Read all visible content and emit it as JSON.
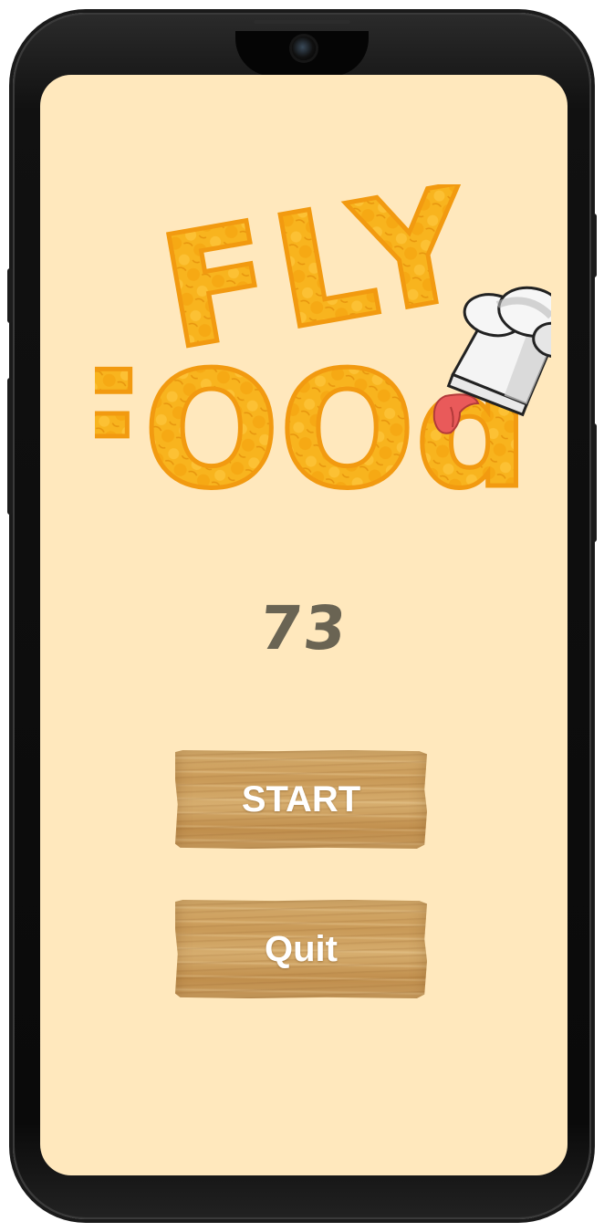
{
  "app": {
    "title_line1": "FLY",
    "title_line2": "FOOd"
  },
  "score": {
    "value": "73"
  },
  "buttons": {
    "start_label": "START",
    "quit_label": "Quit"
  },
  "colors": {
    "background": "#ffe8bd",
    "logo_fill": "#f7b21c",
    "logo_outline": "#f39c12",
    "score_text": "#6a6453",
    "wood": "#c99a58",
    "button_text": "#ffffff"
  },
  "icons": {
    "logo_decoration": "chef-hat-icon",
    "tongue": "tongue-icon"
  }
}
